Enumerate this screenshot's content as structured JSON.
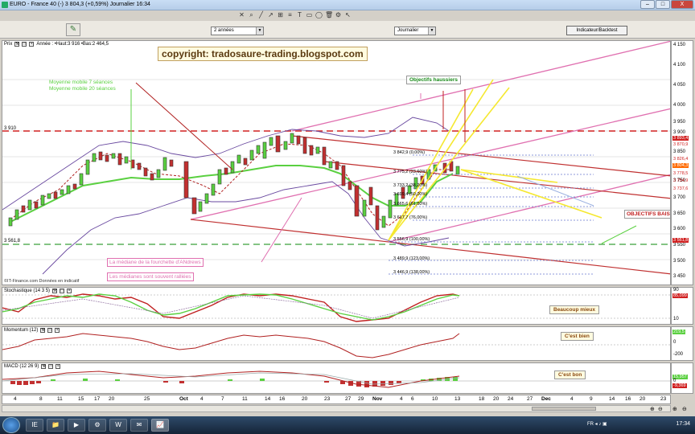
{
  "window": {
    "title": "EURO - France 40 (-)    3 804,3 (+0,59%)    Journalier  16:34",
    "minimize": "–",
    "maximize": "□",
    "close": "X"
  },
  "toolbar": {
    "icons": [
      "pointer-icon",
      "zoom-icon",
      "line-icon",
      "arrow-icon",
      "channel-icon",
      "fibonacci-icon",
      "text-icon",
      "rectangle-icon",
      "ellipse-icon",
      "delete-icon",
      "settings-icon",
      "cursor-icon"
    ],
    "glyphs": [
      "✕",
      "⌕",
      "╱",
      "↗",
      "⊞",
      "≡",
      "T",
      "▭",
      "◯",
      "🗑",
      "⚙",
      "↖"
    ]
  },
  "controls": {
    "period": "2 années",
    "interval": "Journalier",
    "indicator_button": "Indicateur/Backtest",
    "draw_tool_glyph": "✎"
  },
  "price_panel": {
    "header": "Prix",
    "legend": "Année : •Haut:3 916 •Bas:2 464,5",
    "copyright": "copyright: tradosaure-trading.blogspot.com",
    "source": "©IT-Finance.com   Données en indicatif",
    "left_level": "3 910",
    "left_level2": "3 561,8",
    "ma_label_1": "Moyenne mobile 7 séances",
    "ma_label_2": "Moyenne mobile 20 séances",
    "objectifs_haussiers": "Objectifs haussiers",
    "objectifs_baissiers": "OBJECTIFS BAIS",
    "mediane_note": "La médiane de la fourchette d'ANdrews",
    "medianes_note": "Les médianes sont souvent ralliées",
    "fib_levels": [
      "3 842,9 (0,00%)",
      "3 775,2 (23,60%)",
      "3 733,2 (38,20%)",
      "3 699,4 (50,00%)",
      "3 665,6 (61,80%)",
      "3 617,7 (76,00%)",
      "3 556,9 (100,00%)",
      "3 489,9 (123,00%)",
      "3 446,9 (138,00%)"
    ],
    "y_labels": [
      "4 150",
      "4 100",
      "4 050",
      "4 000",
      "3 950",
      "3 900",
      "3 850",
      "3 800",
      "3 750",
      "3 700",
      "3 650",
      "3 600",
      "3 550",
      "3 500",
      "3 450"
    ],
    "y_tags": [
      {
        "text": "3 893,4",
        "color": "#d02020"
      },
      {
        "text": "3 870,9",
        "color": "#d02020"
      },
      {
        "text": "3 826,4",
        "color": "#d02020"
      },
      {
        "text": "3 804,3",
        "color": "#ff6a00"
      },
      {
        "text": "3 778,5",
        "color": "#d02020"
      },
      {
        "text": "3 754,9",
        "color": "#d02020"
      },
      {
        "text": "3 737,6",
        "color": "#d02020"
      },
      {
        "text": "3 561,8",
        "color": "#d02020"
      }
    ]
  },
  "stoch_panel": {
    "header": "Stochastique (14 3 5)",
    "note": "Beaucoup mieux",
    "y_labels": [
      "90",
      "85",
      "10"
    ],
    "tag": "85,099"
  },
  "momentum_panel": {
    "header": "Momentum (12)",
    "note": "C'est bien",
    "y_labels": [
      "200",
      "0",
      "-200"
    ],
    "tag": "219,5"
  },
  "macd_panel": {
    "header": "MACD (12 26 9)",
    "note": "C'est bon",
    "y_labels": [
      "0"
    ],
    "tag1": "15,957",
    "tag2": "-9,369"
  },
  "xaxis": {
    "ticks": [
      "4",
      "8",
      "11",
      "15",
      "17",
      "20",
      "25",
      "Oct",
      "4",
      "7",
      "11",
      "14",
      "16",
      "20",
      "23",
      "27",
      "29",
      "Nov",
      "4",
      "6",
      "10",
      "13",
      "18",
      "20",
      "24",
      "27",
      "Dec",
      "4",
      "9",
      "14",
      "16",
      "20",
      "23"
    ]
  },
  "statusbar": {
    "zoom_icons": [
      "⊕",
      "⊖",
      "⊕",
      "⊖"
    ]
  },
  "taskbar": {
    "apps": [
      "IE",
      "📁",
      "▶",
      "⚙",
      "W",
      "✉",
      "📈"
    ],
    "tray": "FR   ◂  ♪  ▣",
    "clock": "17:34"
  }
}
